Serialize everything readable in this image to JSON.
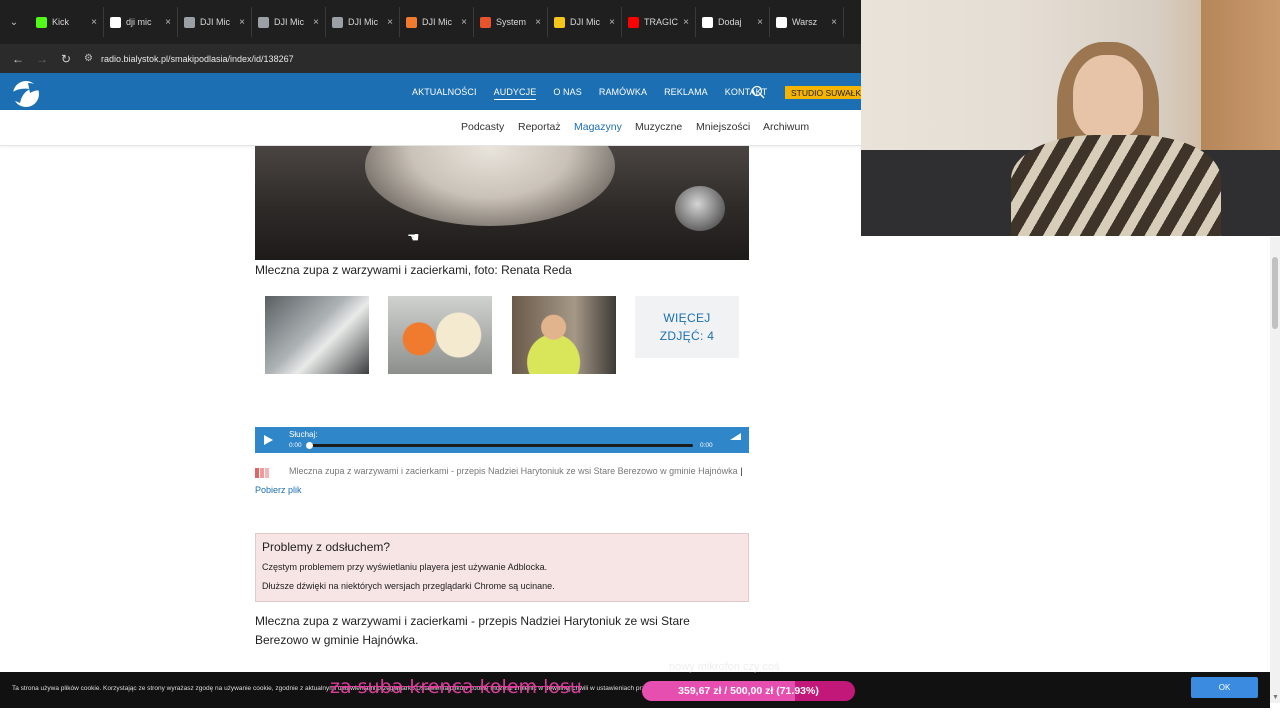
{
  "browser": {
    "tabs": [
      {
        "label": "Kick",
        "color": "#53fc18"
      },
      {
        "label": "dji mic",
        "color": "#ffffff"
      },
      {
        "label": "DJI Mic",
        "color": "#9aa0a6"
      },
      {
        "label": "DJI Mic",
        "color": "#9aa0a6"
      },
      {
        "label": "DJI Mic",
        "color": "#9aa0a6"
      },
      {
        "label": "DJI Mic",
        "color": "#f07a2e"
      },
      {
        "label": "System",
        "color": "#e8532b"
      },
      {
        "label": "DJI Mic",
        "color": "#f5c518"
      },
      {
        "label": "TRAGIC",
        "color": "#ff0000"
      },
      {
        "label": "Dodaj",
        "color": "#ffffff"
      },
      {
        "label": "Warsz",
        "color": "#ffffff"
      }
    ],
    "url": "radio.bialystok.pl/smakipodlasia/index/id/138267"
  },
  "site": {
    "nav": [
      "AKTUALNOŚCI",
      "AUDYCJE",
      "O NAS",
      "RAMÓWKA",
      "REKLAMA",
      "KONTAKT"
    ],
    "nav_active": "AUDYCJE",
    "studio_button": "STUDIO SUWAŁKI",
    "subnav": [
      "Podcasty",
      "Reportaż",
      "Magazyny",
      "Muzyczne",
      "Mniejszości",
      "Archiwum"
    ],
    "subnav_active": "Magazyny",
    "accent": "#1b6fb2"
  },
  "content": {
    "caption": "Mleczna zupa z warzywami i zacierkami, foto: Renata Reda",
    "more_photos_line1": "WIĘCEJ",
    "more_photos_line2": "ZDJĘĆ: 4",
    "player": {
      "listen_label": "Słuchaj:",
      "time_start": "0:00",
      "time_end": "0:00",
      "progress": 0
    },
    "file_description": "Mleczna zupa z warzywami i zacierkami - przepis Nadziei Harytoniuk ze wsi Stare Berezowo w gminie Hajnówka",
    "download_separator": "|",
    "download_link": "Pobierz plik",
    "problems": {
      "title": "Problemy z odsłuchem?",
      "line1": "Częstym problemem przy wyświetlaniu playera jest używanie Adblocka.",
      "line2": "Dłuższe dźwięki na niektórych wersjach przeglądarki Chrome są ucinane."
    },
    "article_text": "Mleczna zupa z warzywami i zacierkami - przepis Nadziei Harytoniuk ze wsi Stare Berezowo w gminie Hajnówka."
  },
  "overlay": {
    "cookie_text": "Ta strona używa plików cookie. Korzystając ze strony wyrażasz zgodę na używanie cookie, zgodnie z aktualnymi ustawieniami przeglądarki. Ustawienia plików cookie możesz zmienić w dowolnej chwili w ustawieniach przeglądarki.",
    "ok_label": "OK",
    "stream_caption": "za suba krenca kolem losu",
    "stream_sub": "nowy mikrofon czy coś",
    "goal_text": "359,67 zł / 500,00 zł (71.93%)",
    "goal_fraction": 0.7193
  }
}
